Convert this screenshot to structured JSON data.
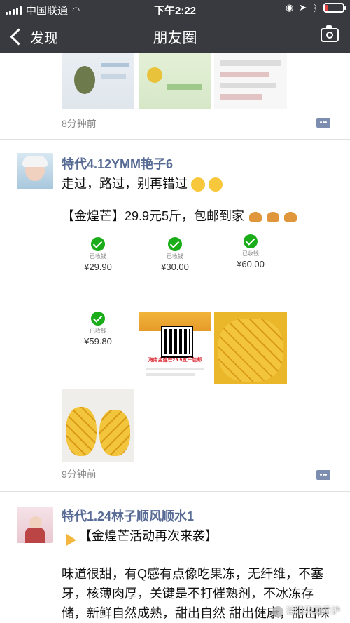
{
  "status": {
    "carrier": "中国联通",
    "time": "下午2:22",
    "battery_level": 0.15,
    "battery_color": "#e64340"
  },
  "nav": {
    "back_label": "发现",
    "title": "朋友圈",
    "camera_icon": "camera-icon"
  },
  "posts": [
    {
      "time": "8分钟前"
    },
    {
      "name": "特代4.12YMM艳子6",
      "line1": "走过，路过，别再错过",
      "line2": "【金煌芒】29.9元5斤，包邮到家",
      "payments": [
        {
          "label": "已收钱",
          "amount": "¥29.90"
        },
        {
          "label": "已收钱",
          "amount": "¥30.00"
        },
        {
          "label": "已收钱",
          "amount": "¥60.00"
        },
        {
          "label": "已收钱",
          "amount": "¥59.80"
        }
      ],
      "qr_caption": "海南金煌芒29.9五斤包邮",
      "time": "9分钟前"
    },
    {
      "name": "特代1.24林子顺风顺水1",
      "line1": "【金煌芒活动再次来袭】",
      "body": "味道很甜，有Q感有点像吃果冻，无纤维，不塞牙，核薄肉厚，关键是不打催熟剂，不冰冻存储，新鲜自然成熟，甜出自然 甜出健康，甜出味道",
      "watermark": "溢阳果园看护"
    }
  ],
  "colors": {
    "nav_bg": "#393a3f",
    "name_blue": "#576b95",
    "wechat_green": "#1aad19"
  }
}
